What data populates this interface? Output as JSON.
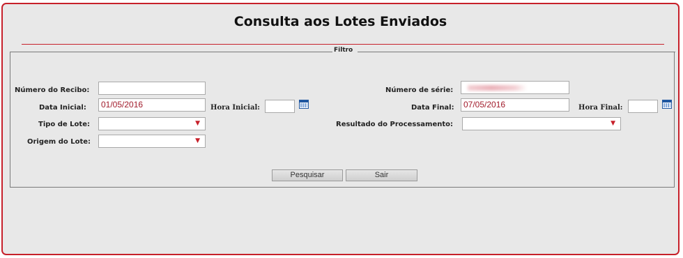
{
  "page": {
    "title": "Consulta aos Lotes Enviados",
    "filter_legend": "Filtro"
  },
  "form": {
    "numero_recibo": {
      "label": "Número do Recibo:",
      "value": ""
    },
    "numero_serie": {
      "label": "Número de série:",
      "value": ""
    },
    "data_inicial": {
      "label": "Data Inicial:",
      "value": "01/05/2016"
    },
    "hora_inicial": {
      "label": "Hora Inicial:",
      "value": ""
    },
    "data_final": {
      "label": "Data Final:",
      "value": "07/05/2016"
    },
    "hora_final": {
      "label": "Hora Final:",
      "value": ""
    },
    "tipo_lote": {
      "label": "Tipo de Lote:",
      "selected": ""
    },
    "resultado_processamento": {
      "label": "Resultado do Processamento:",
      "selected": ""
    },
    "origem_lote": {
      "label": "Origem do Lote:",
      "selected": ""
    }
  },
  "buttons": {
    "pesquisar": "Pesquisar",
    "sair": "Sair"
  },
  "icons": {
    "calendar": "calendar-icon",
    "dropdown": "chevron-down-icon"
  },
  "colors": {
    "accent": "#c7202a",
    "panel_bg": "#e8e8e8",
    "input_text": "#a11b2b"
  }
}
